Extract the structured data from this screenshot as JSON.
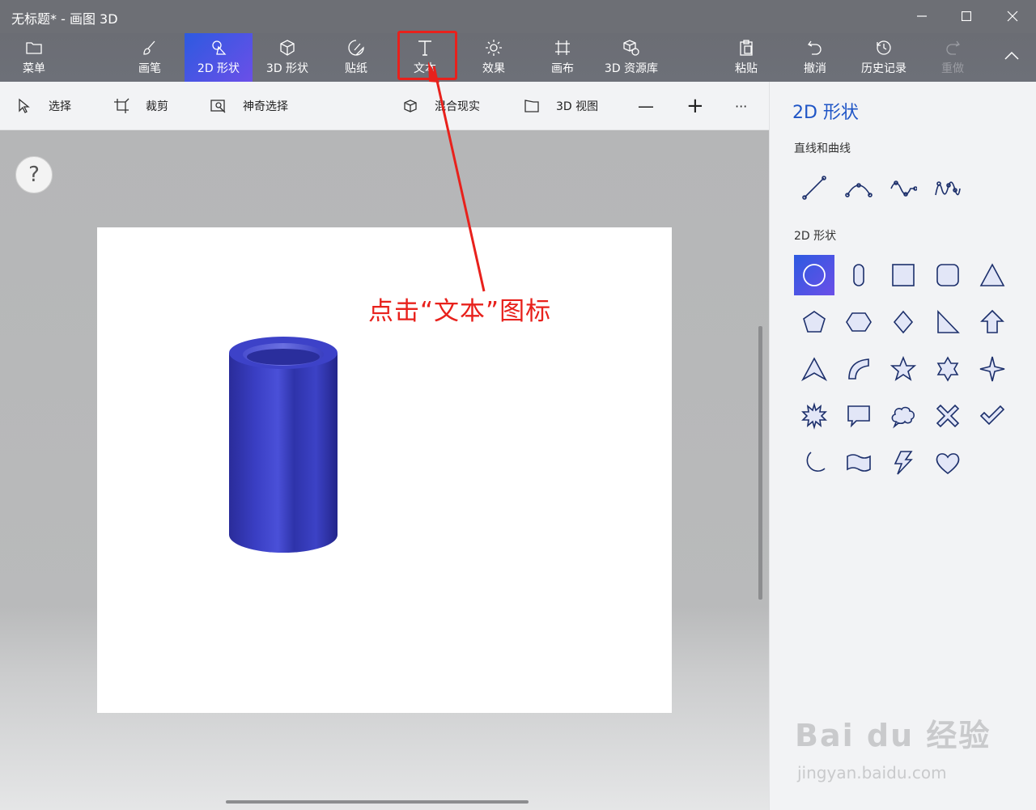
{
  "window": {
    "title": "无标题* - 画图 3D",
    "minimize": "—",
    "maximize": "☐",
    "close": "✕"
  },
  "toolbar": {
    "items": [
      {
        "label": "菜单",
        "icon": "folder-icon"
      },
      {
        "label": "画笔",
        "icon": "brush-icon"
      },
      {
        "label": "2D 形状",
        "icon": "shapes-2d-icon",
        "active": true
      },
      {
        "label": "3D 形状",
        "icon": "cube-icon"
      },
      {
        "label": "贴纸",
        "icon": "sticker-icon"
      },
      {
        "label": "文本",
        "icon": "text-t-icon"
      },
      {
        "label": "效果",
        "icon": "sun-effects-icon"
      },
      {
        "label": "画布",
        "icon": "canvas-crop-icon"
      },
      {
        "label": "3D 资源库",
        "icon": "library-3d-icon"
      },
      {
        "label": "粘贴",
        "icon": "clipboard-icon"
      },
      {
        "label": "撤消",
        "icon": "undo-icon"
      },
      {
        "label": "历史记录",
        "icon": "history-icon"
      },
      {
        "label": "重做",
        "icon": "redo-icon",
        "disabled": true
      }
    ],
    "collapse_icon": "chevron-up-icon"
  },
  "subbar": {
    "select": "选择",
    "crop": "裁剪",
    "magic_select": "神奇选择",
    "mixed_reality": "混合现实",
    "view_3d": "3D 视图",
    "zoom_out": "—",
    "zoom_in": "+",
    "more": "···"
  },
  "canvas": {
    "help": "?",
    "annotation": "点击“文本”图标",
    "object": "blue-cylinder-tube"
  },
  "panel": {
    "title": "2D 形状",
    "lines_label": "直线和曲线",
    "shapes_label": "2D 形状",
    "lines": [
      "line-icon",
      "curve-icon",
      "curve-2-icon",
      "curve-3-icon"
    ],
    "shapes": [
      "circle-icon",
      "capsule-icon",
      "square-icon",
      "rounded-square-icon",
      "triangle-icon",
      "pentagon-icon",
      "hexagon-icon",
      "diamond-icon",
      "right-triangle-icon",
      "arrow-up-icon",
      "arrowhead-icon",
      "quarter-circle-icon",
      "star5-icon",
      "star6-icon",
      "star4-icon",
      "burst-icon",
      "speech-bubble-icon",
      "thought-bubble-icon",
      "x-mark-icon",
      "checkmark-icon",
      "moon-icon",
      "banner-icon",
      "lightning-icon",
      "heart-icon"
    ]
  },
  "watermark": {
    "brand": "Bai du 经验",
    "url": "jingyan.baidu.com"
  },
  "colors": {
    "accent": "#2d5ae0",
    "annotation": "#e8211c",
    "panel_title": "#1f55c6",
    "shape_stroke": "#1c2f6b"
  }
}
